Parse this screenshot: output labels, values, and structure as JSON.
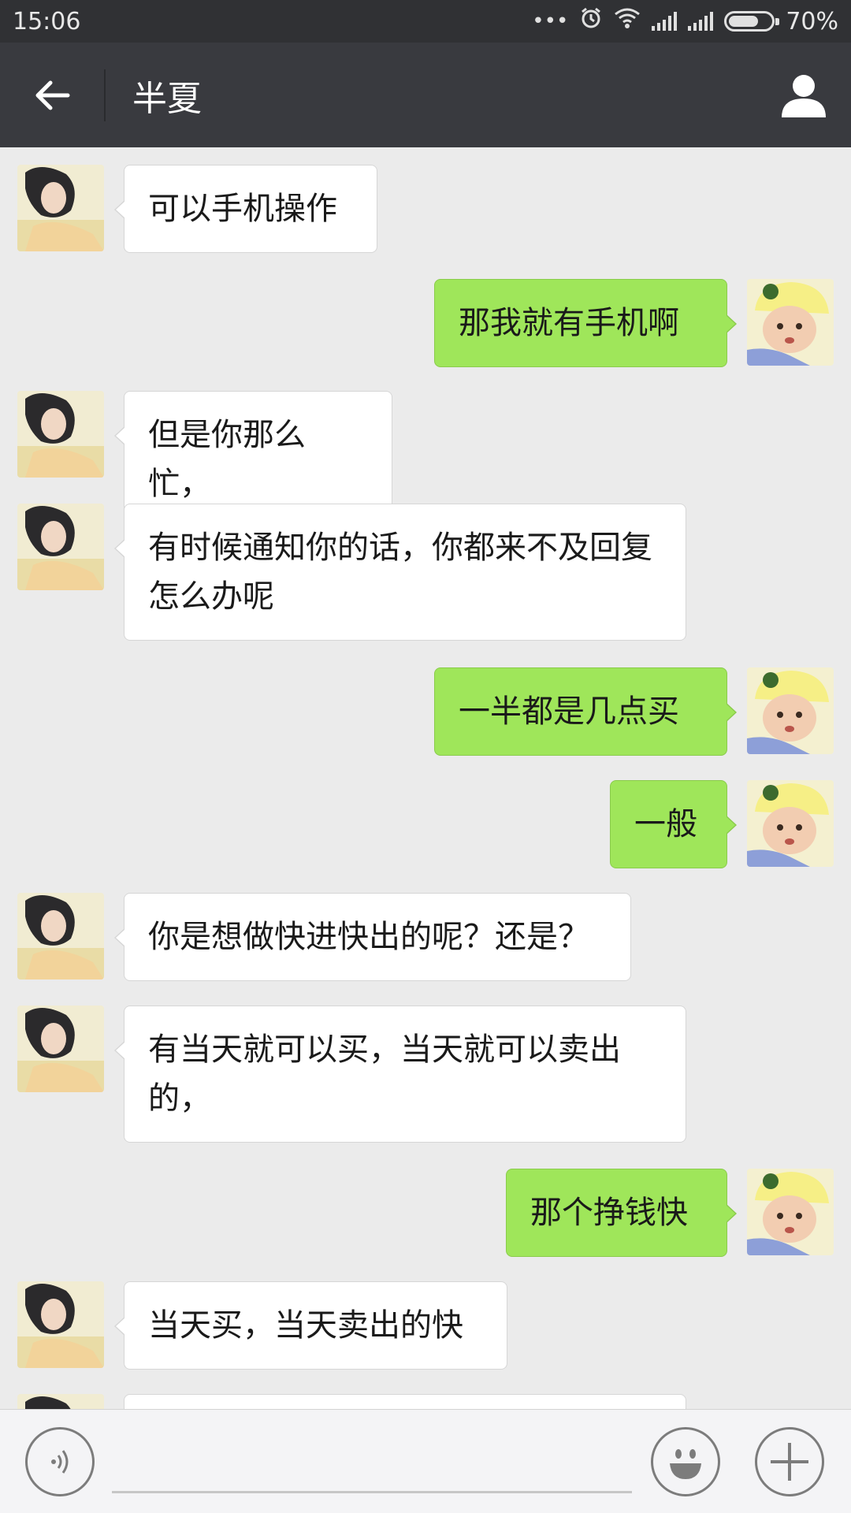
{
  "status_bar": {
    "time": "15:06",
    "dots": "•••",
    "battery_percent": "70%",
    "battery_level": 0.7,
    "icons": [
      "more-dots-icon",
      "alarm-icon",
      "wifi-icon",
      "signal-icon",
      "signal-icon",
      "battery-icon"
    ]
  },
  "header": {
    "title": "半夏",
    "back_icon": "back-arrow-icon",
    "profile_icon": "person-icon"
  },
  "messages": [
    {
      "side": "left",
      "text": "可以手机操作"
    },
    {
      "side": "right",
      "text": "那我就有手机啊"
    },
    {
      "side": "left",
      "text": "但是你那么忙，"
    },
    {
      "side": "left",
      "text": "有时候通知你的话，你都来不及回复怎么办呢"
    },
    {
      "side": "right",
      "text": "一半都是几点买"
    },
    {
      "side": "right",
      "text": "一般"
    },
    {
      "side": "left",
      "text": "你是想做快进快出的呢？还是？"
    },
    {
      "side": "left",
      "text": "有当天就可以买，当天就可以卖出的，"
    },
    {
      "side": "right",
      "text": "那个挣钱快"
    },
    {
      "side": "left",
      "text": "当天买，当天卖出的快"
    },
    {
      "side": "left",
      "text": ""
    }
  ],
  "input_bar": {
    "voice_icon": "voice-icon",
    "emoji_icon": "emoji-icon",
    "plus_icon": "plus-icon",
    "input_value": ""
  },
  "colors": {
    "status_bar": "#303134",
    "header": "#393a3f",
    "chat_background": "#ebebeb",
    "sent_bubble": "#9fe65a",
    "received_bubble": "#ffffff"
  }
}
